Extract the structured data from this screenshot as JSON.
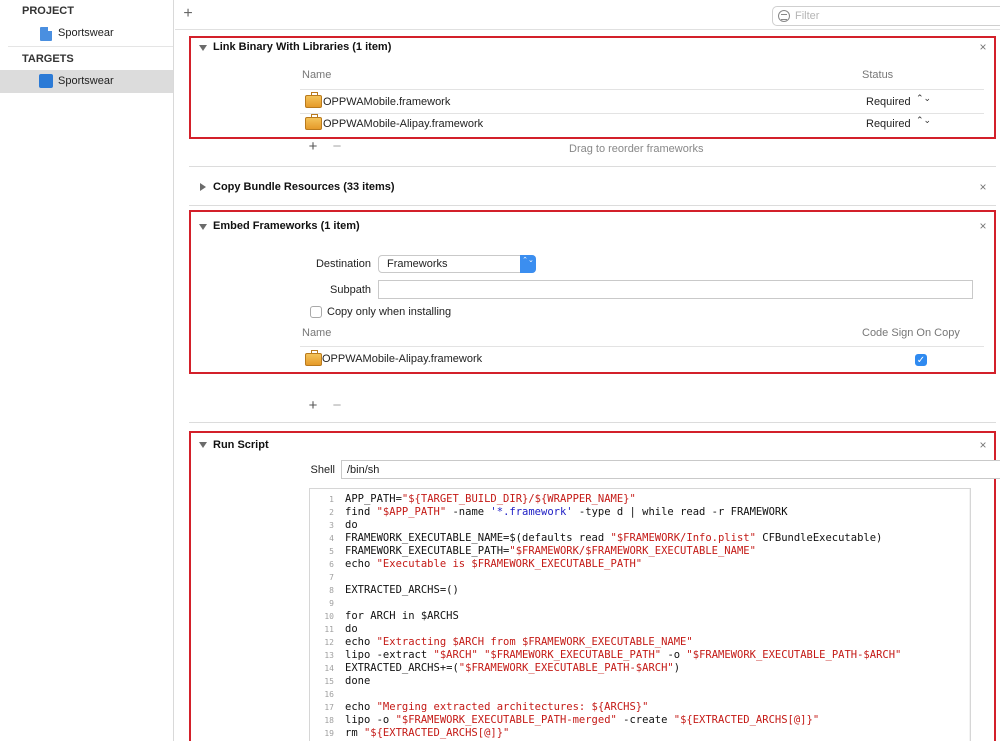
{
  "sidebar": {
    "project_header": "PROJECT",
    "project_item": "Sportswear",
    "targets_header": "TARGETS",
    "target_item": "Sportswear"
  },
  "toolbar": {
    "add_symbol": "+",
    "filter_placeholder": "Filter"
  },
  "link_binary": {
    "title": "Link Binary With Libraries (1 item)",
    "col_name": "Name",
    "col_status": "Status",
    "rows": [
      {
        "name": "OPPWAMobile.framework",
        "status": "Required"
      },
      {
        "name": "OPPWAMobile-Alipay.framework",
        "status": "Required"
      }
    ],
    "hint": "Drag to reorder frameworks"
  },
  "copy_bundle": {
    "title": "Copy Bundle Resources (33 items)"
  },
  "embed": {
    "title": "Embed Frameworks (1 item)",
    "destination_label": "Destination",
    "destination_value": "Frameworks",
    "subpath_label": "Subpath",
    "subpath_value": "",
    "copy_only_label": "Copy only when installing",
    "col_name": "Name",
    "col_codesign": "Code Sign On Copy",
    "rows": [
      {
        "name": "OPPWAMobile-Alipay.framework",
        "codesign": true
      }
    ]
  },
  "run_script": {
    "title": "Run Script",
    "shell_label": "Shell",
    "shell_value": "/bin/sh",
    "lines": [
      "APP_PATH=\"${TARGET_BUILD_DIR}/${WRAPPER_NAME}\"",
      "find \"$APP_PATH\" -name '*.framework' -type d | while read -r FRAMEWORK",
      "do",
      "FRAMEWORK_EXECUTABLE_NAME=$(defaults read \"$FRAMEWORK/Info.plist\" CFBundleExecutable)",
      "FRAMEWORK_EXECUTABLE_PATH=\"$FRAMEWORK/$FRAMEWORK_EXECUTABLE_NAME\"",
      "echo \"Executable is $FRAMEWORK_EXECUTABLE_PATH\"",
      "",
      "EXTRACTED_ARCHS=()",
      "",
      "for ARCH in $ARCHS",
      "do",
      "echo \"Extracting $ARCH from $FRAMEWORK_EXECUTABLE_NAME\"",
      "lipo -extract \"$ARCH\" \"$FRAMEWORK_EXECUTABLE_PATH\" -o \"$FRAMEWORK_EXECUTABLE_PATH-$ARCH\"",
      "EXTRACTED_ARCHS+=(\"$FRAMEWORK_EXECUTABLE_PATH-$ARCH\")",
      "done",
      "",
      "echo \"Merging extracted architectures: ${ARCHS}\"",
      "lipo -o \"$FRAMEWORK_EXECUTABLE_PATH-merged\" -create \"${EXTRACTED_ARCHS[@]}\"",
      "rm \"${EXTRACTED_ARCHS[@]}\""
    ]
  },
  "colors": {
    "highlight_border": "#d3202a",
    "selection": "#dcdcdc",
    "accent": "#2f8af0",
    "string": "#c41a16"
  },
  "icons": {
    "close": "×",
    "add": "+",
    "remove": "−",
    "stepper": "⌃⌄",
    "checkmark": "✓"
  }
}
